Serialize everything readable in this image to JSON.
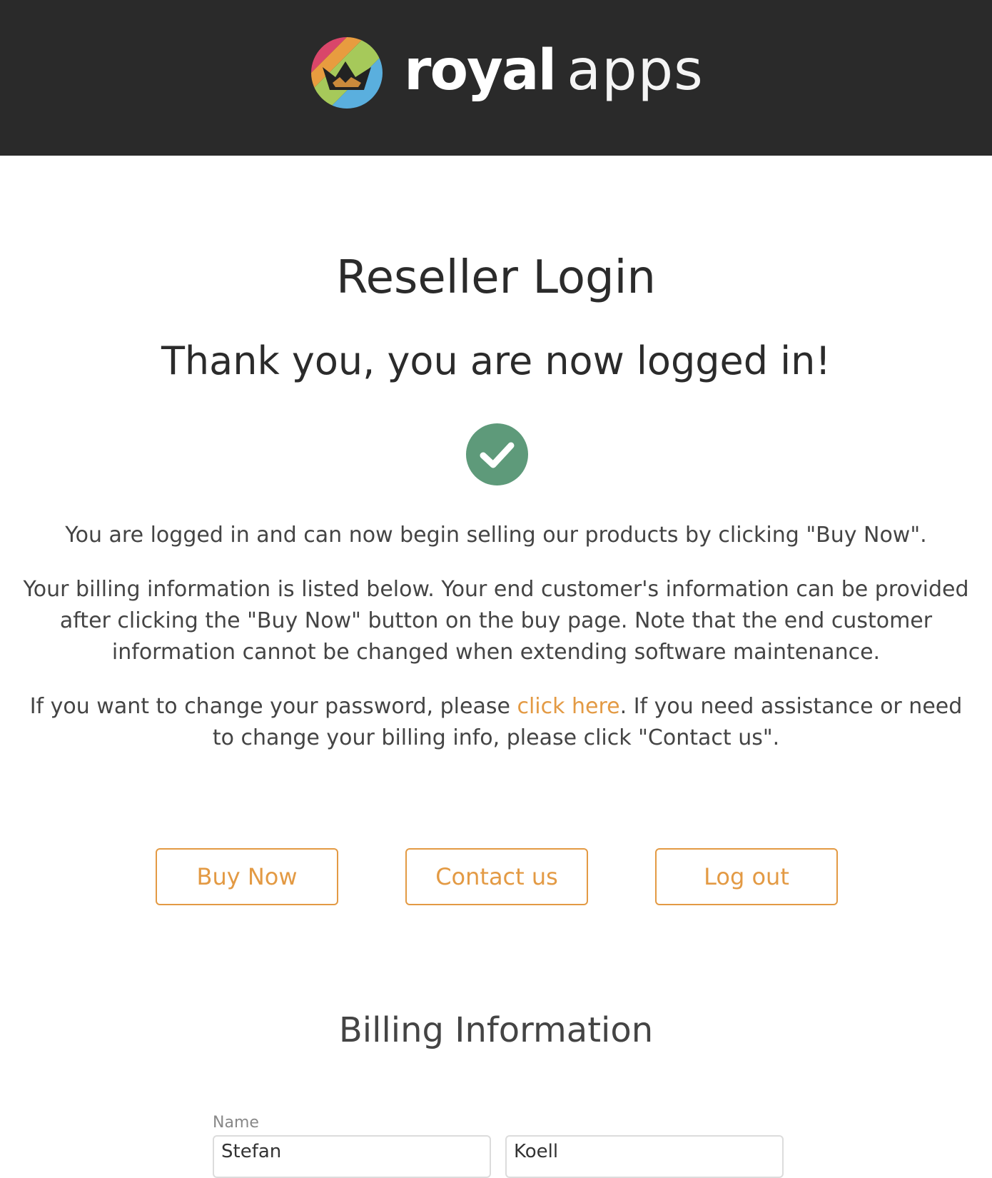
{
  "header": {
    "brand_word_1": "royal",
    "brand_word_2": "apps",
    "background_color": "#2a2a2a",
    "logo_colors": [
      "#d9466a",
      "#e89c3f",
      "#a6c95a",
      "#5aafde"
    ]
  },
  "page": {
    "title": "Reseller Login",
    "subtitle": "Thank you, you are now logged in!",
    "success_icon_color": "#5e9a7a"
  },
  "messages": {
    "p1": "You are logged in and can now begin selling our products by clicking \"Buy Now\".",
    "p2": "Your billing information is listed below. Your end customer's information can be provided after clicking the \"Buy Now\" button on the buy page. Note that the end customer information cannot be changed when extending software maintenance.",
    "p3_before": "If you want to change your password, please ",
    "p3_link": "click here",
    "p3_after": ". If you need assistance or need to change your billing info, please click \"Contact us\"."
  },
  "actions": {
    "buy_now": "Buy Now",
    "contact_us": "Contact us",
    "log_out": "Log out",
    "accent_color": "#e39a44"
  },
  "billing": {
    "section_title": "Billing Information",
    "name_label": "Name",
    "first_name_value": "Stefan",
    "last_name_value": "Koell"
  }
}
